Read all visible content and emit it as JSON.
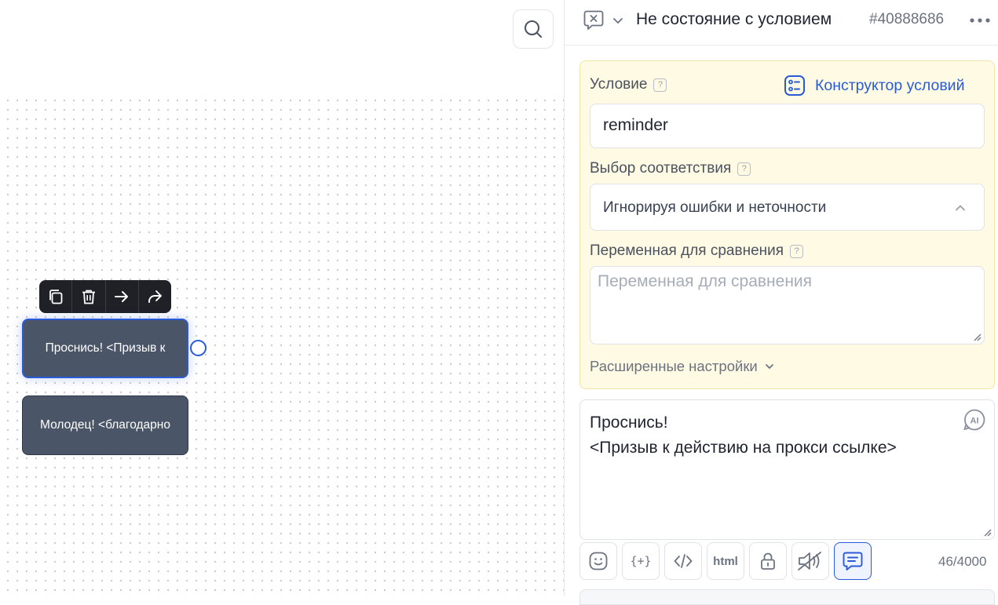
{
  "canvas": {
    "toolbar": {
      "icons": [
        "copy-icon",
        "trash-icon",
        "arrow-right-icon",
        "share-icon"
      ]
    },
    "nodes": [
      {
        "text": "Проснись! <Призыв к",
        "selected": true
      },
      {
        "text": "Молодец! <благодарно",
        "selected": false
      }
    ]
  },
  "panel": {
    "header": {
      "title": "Не состояние с условием",
      "id": "#40888686"
    },
    "condition": {
      "label": "Условие",
      "builder_label": "Конструктор условий",
      "value": "reminder",
      "match_label": "Выбор соответствия",
      "match_value": "Игнорируя ошибки и неточности",
      "compare_label": "Переменная для сравнения",
      "compare_placeholder": "Переменная для сравнения",
      "advanced_label": "Расширенные настройки",
      "help": "?"
    },
    "message": {
      "lines": [
        "Проснись!",
        "<Призыв к действию на прокси ссылке>"
      ],
      "ai_label": "AI"
    },
    "toolbar": {
      "buttons": [
        "emoji-icon",
        "variable-icon",
        "code-icon",
        "html",
        "lock-icon",
        "mute-icon",
        "comment-icon"
      ],
      "html_label": "html",
      "var_label": "{+}",
      "counter": "46/4000"
    },
    "colors": {
      "accent": "#2a5bd7",
      "node": "#4b5568",
      "condition_bg": "#fefae3"
    }
  }
}
